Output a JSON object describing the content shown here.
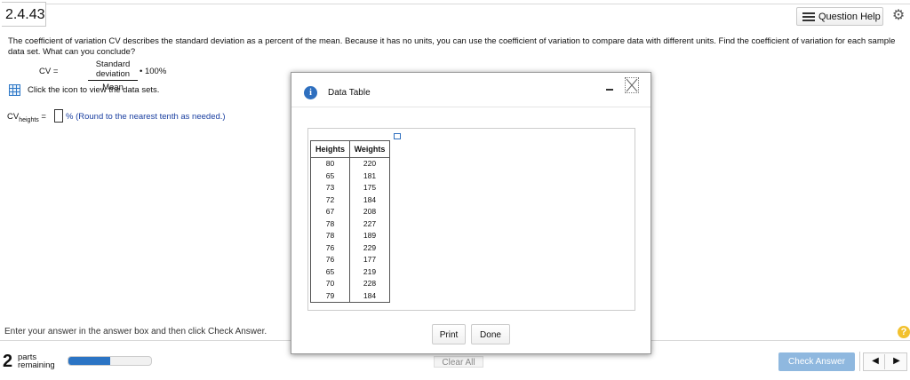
{
  "header": {
    "question_number": "2.4.43",
    "question_help_label": "Question Help"
  },
  "question": {
    "text": "The coefficient of variation CV describes the standard deviation as a percent of the mean. Because it has no units, you can use the coefficient of variation to compare data with different units. Find the coefficient of variation for each sample data set. What can you conclude?",
    "formula_lhs": "CV =",
    "formula_numerator": "Standard deviation",
    "formula_denominator": "Mean",
    "formula_tail": "• 100%",
    "data_link_text": "Click the icon to view the data sets.",
    "answer_prefix": "CV",
    "answer_subscript": "heights",
    "answer_equals": " =",
    "answer_value": "",
    "answer_suffix": "% (Round to the nearest tenth as needed.)"
  },
  "footer": {
    "instruction": "Enter your answer in the answer box and then click Check Answer.",
    "parts_count": "2",
    "parts_label_1": "parts",
    "parts_label_2": "remaining",
    "progress_fraction": 0.5,
    "clear_all_label": "Clear All",
    "check_answer_label": "Check Answer",
    "help_symbol": "?",
    "prev_symbol": "◀",
    "next_symbol": "▶"
  },
  "dialog": {
    "title": "Data Table",
    "columns": [
      "Heights",
      "Weights"
    ],
    "rows": [
      [
        "80",
        "220"
      ],
      [
        "65",
        "181"
      ],
      [
        "73",
        "175"
      ],
      [
        "72",
        "184"
      ],
      [
        "67",
        "208"
      ],
      [
        "78",
        "227"
      ],
      [
        "78",
        "189"
      ],
      [
        "76",
        "229"
      ],
      [
        "76",
        "177"
      ],
      [
        "65",
        "219"
      ],
      [
        "70",
        "228"
      ],
      [
        "79",
        "184"
      ]
    ],
    "print_label": "Print",
    "done_label": "Done"
  },
  "colors": {
    "accent": "#2e6fbf",
    "progress": "#2b74c4",
    "check_answer_bg": "#8fb8df",
    "help_icon": "#f2c12e",
    "note_text": "#1a3fa0"
  }
}
